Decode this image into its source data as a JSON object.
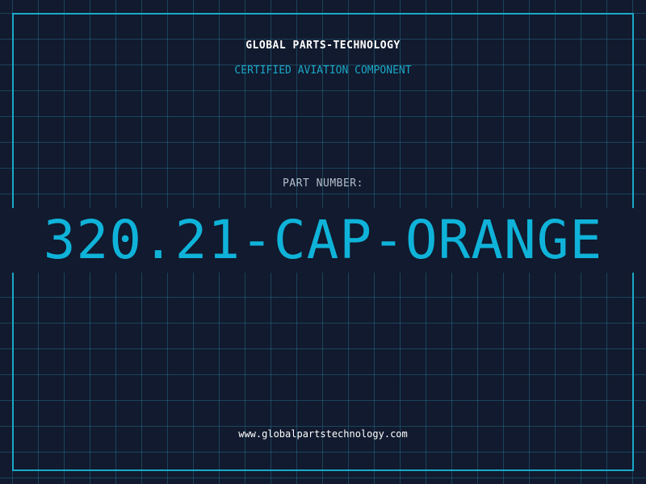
{
  "header": {
    "company": "GLOBAL PARTS-TECHNOLOGY",
    "subtitle": "CERTIFIED AVIATION COMPONENT"
  },
  "part": {
    "label": "PART NUMBER:",
    "number": "320.21-CAP-ORANGE"
  },
  "footer": {
    "url": "www.globalpartstechnology.com"
  },
  "colors": {
    "background": "#111a2e",
    "accent": "#1ba8c7",
    "part_number": "#0fb3d9",
    "label": "#b3bfcc",
    "text": "#ffffff"
  }
}
